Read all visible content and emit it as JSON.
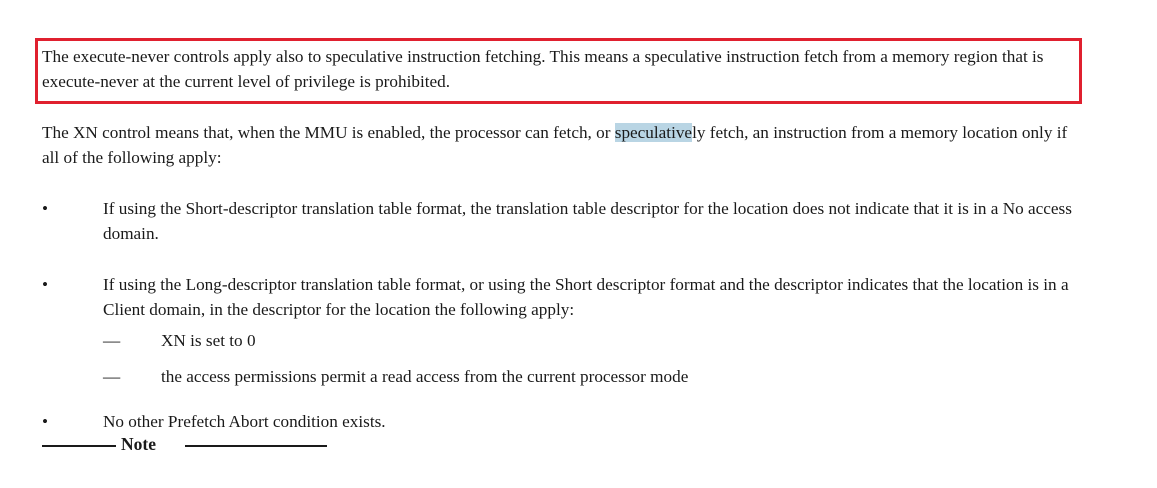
{
  "highlighted_paragraph": "The execute-never controls apply also to speculative instruction fetching. This means a speculative instruction fetch from a memory region that is execute-never at the current level of privilege is prohibited.",
  "paragraph2": {
    "before": "The XN control means that, when the MMU is enabled, the processor can fetch, or ",
    "selected": "speculative",
    "after": "ly fetch, an instruction from a memory location only if all of the following apply:"
  },
  "bullets": [
    {
      "marker": "•",
      "text": "If using the Short-descriptor translation table format, the translation table descriptor for the location does not indicate that it is in a No access domain."
    },
    {
      "marker": "•",
      "text": "If using the Long-descriptor translation table format, or using the Short descriptor format and the descriptor indicates that the location is in a Client domain, in the descriptor for the location the following apply:",
      "subitems": [
        {
          "marker": "—",
          "text": "XN is set to 0"
        },
        {
          "marker": "—",
          "text": "the access permissions permit a read access from the current processor mode"
        }
      ]
    },
    {
      "marker": "•",
      "text": "No other Prefetch Abort condition exists."
    }
  ],
  "note": {
    "label": "Note"
  },
  "colors": {
    "highlight_border": "#e0202f",
    "selection": "#b9d5e4",
    "text": "#1a1a1a"
  }
}
